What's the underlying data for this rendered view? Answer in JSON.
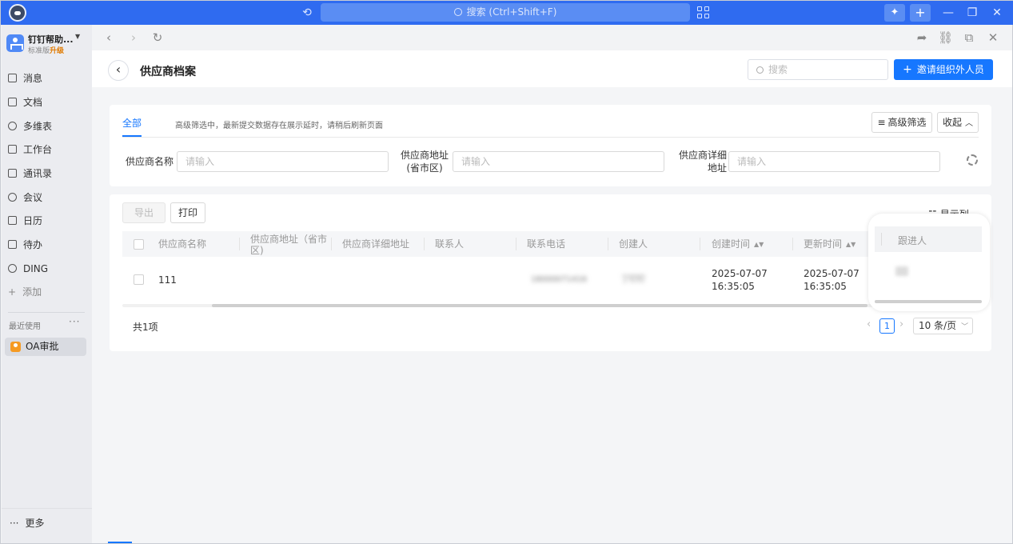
{
  "titlebar": {
    "search_placeholder": "搜索 (Ctrl+Shift+F)",
    "brand_color": "#2f6bf0"
  },
  "sidebar": {
    "org_name": "钉钉帮助...",
    "org_edition": "标准版",
    "org_upgrade": "升级",
    "nav": [
      {
        "label": "消息",
        "icon": "message-icon"
      },
      {
        "label": "文档",
        "icon": "document-icon"
      },
      {
        "label": "多维表",
        "icon": "table-icon"
      },
      {
        "label": "工作台",
        "icon": "workbench-icon"
      },
      {
        "label": "通讯录",
        "icon": "contacts-icon"
      },
      {
        "label": "会议",
        "icon": "meeting-icon"
      },
      {
        "label": "日历",
        "icon": "calendar-icon"
      },
      {
        "label": "待办",
        "icon": "todo-icon"
      },
      {
        "label": "DING",
        "icon": "ding-icon"
      }
    ],
    "add_label": "添加",
    "recent_label": "最近使用",
    "recent_item": "OA审批",
    "more_label": "更多"
  },
  "page": {
    "title": "供应商档案",
    "search_placeholder": "搜索",
    "invite_label": "邀请组织外人员",
    "accent_color": "#1677ff"
  },
  "filter": {
    "tab_all": "全部",
    "note": "高级筛选中，最新提交数据存在展示延时，请稍后刷新页面",
    "advanced_label": "高级筛选",
    "collapse_label": "收起",
    "fields": [
      {
        "label_line1": "供应商名称",
        "label_line2": "",
        "placeholder": "请输入"
      },
      {
        "label_line1": "供应商地址",
        "label_line2": "(省市区)",
        "placeholder": "请输入"
      },
      {
        "label_line1": "供应商详细",
        "label_line2": "地址",
        "placeholder": "请输入"
      }
    ]
  },
  "table": {
    "export_label": "导出",
    "print_label": "打印",
    "display_columns_label": "显示列",
    "columns": [
      {
        "line1": "供应商名称",
        "line2": ""
      },
      {
        "line1": "供应商地址（省市",
        "line2": "区)"
      },
      {
        "line1": "供应商详细地址",
        "line2": ""
      },
      {
        "line1": "联系人",
        "line2": ""
      },
      {
        "line1": "联系电话",
        "line2": ""
      },
      {
        "line1": "创建人",
        "line2": ""
      },
      {
        "line1": "创建时间",
        "line2": ""
      },
      {
        "line1": "更新时间",
        "line2": ""
      }
    ],
    "row": {
      "name": "111",
      "phone": "18000071416",
      "creator": "丁钉钉",
      "created_date": "2025-07-07",
      "created_time": "16:35:05",
      "updated_date": "2025-07-07",
      "updated_time": "16:35:05"
    },
    "total_label": "共1项",
    "current_page": "1",
    "page_size_label": "10 条/页"
  },
  "highlight": {
    "column_label": "跟进人"
  }
}
